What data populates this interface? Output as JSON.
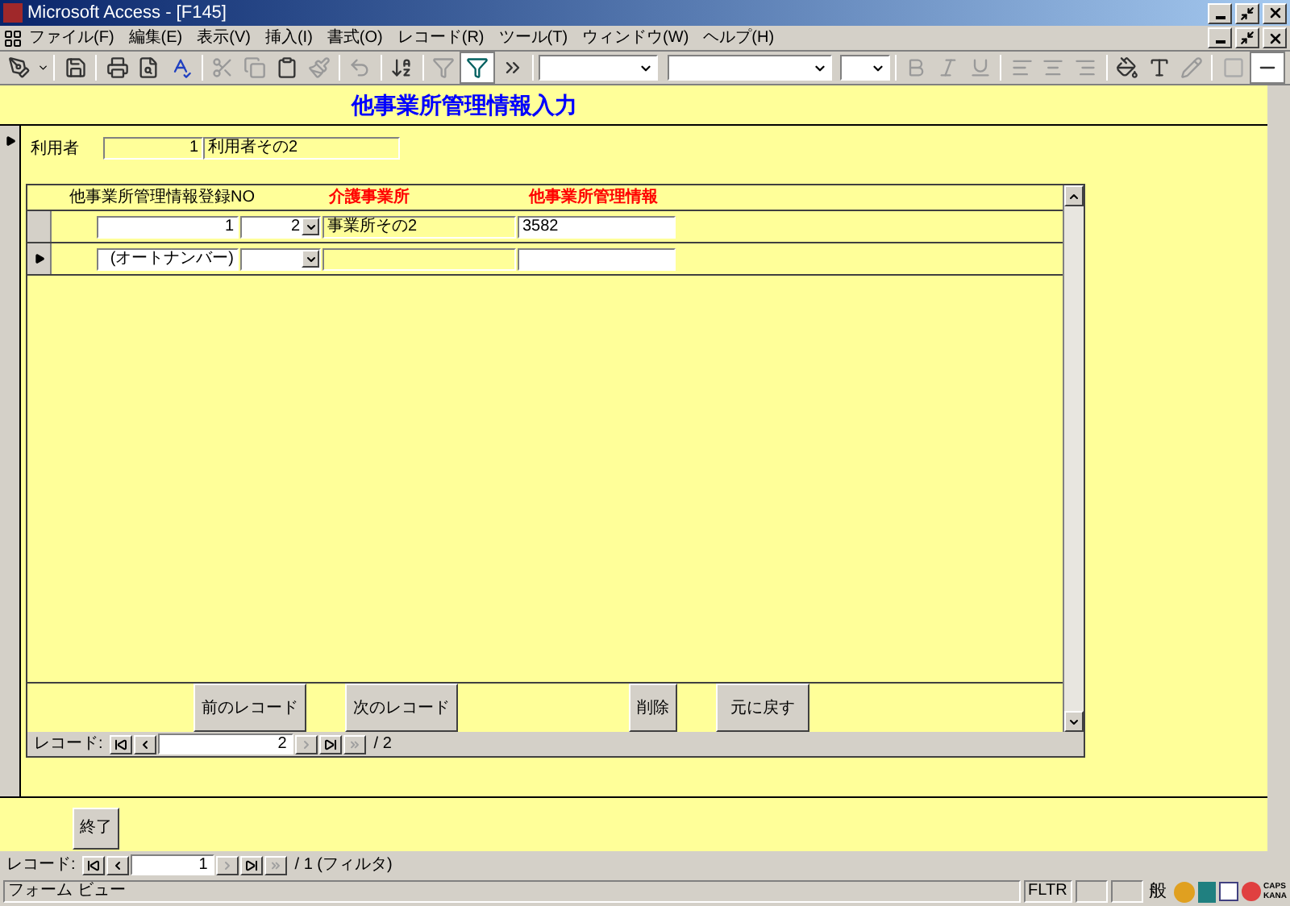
{
  "window": {
    "title": "Microsoft Access - [F145]"
  },
  "menu": [
    "ファイル(F)",
    "編集(E)",
    "表示(V)",
    "挿入(I)",
    "書式(O)",
    "レコード(R)",
    "ツール(T)",
    "ウィンドウ(W)",
    "ヘルプ(H)"
  ],
  "form": {
    "title": "他事業所管理情報入力",
    "user_label": "利用者",
    "user_id": "1",
    "user_name": "利用者その2"
  },
  "subform": {
    "columns": [
      {
        "label": "他事業所管理情報登録NO",
        "required": false
      },
      {
        "label": "介護事業所",
        "required": true
      },
      {
        "label": "他事業所管理情報",
        "required": true
      }
    ],
    "rows": [
      {
        "no": "1",
        "office_id": "2",
        "office_name": "事業所その2",
        "info": "3582",
        "selected": false
      },
      {
        "no": "(オートナンバー)",
        "office_id": "",
        "office_name": "",
        "info": "",
        "selected": true
      }
    ],
    "buttons": [
      "前のレコード",
      "次のレコード",
      "削除",
      "元に戻す"
    ],
    "navigator": {
      "label": "レコード:",
      "current": "2",
      "total": "/ 2"
    }
  },
  "close_button": "終了",
  "navigator": {
    "label": "レコード:",
    "current": "1",
    "total": "/ 1 (フィルタ)"
  },
  "status_bar": {
    "text": "フォーム ビュー",
    "filter": "FLTR",
    "ime": "般",
    "caps": "CAPS",
    "kana": "KANA"
  }
}
